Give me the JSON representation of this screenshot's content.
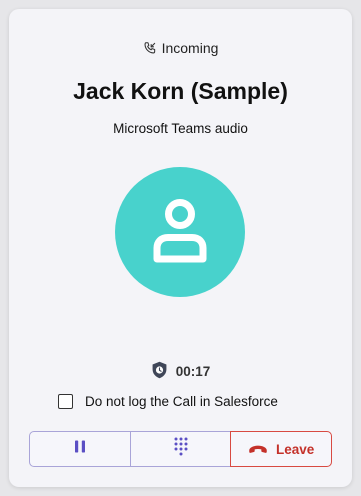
{
  "call": {
    "status_label": "Incoming",
    "caller_name": "Jack Korn (Sample)",
    "audio_label": "Microsoft Teams audio",
    "duration": "00:17"
  },
  "options": {
    "do_not_log_label": "Do not log the Call in Salesforce",
    "do_not_log_checked": false
  },
  "controls": {
    "leave_label": "Leave"
  },
  "colors": {
    "avatar_bg": "#48d2cc",
    "accent": "#5b4fc4",
    "leave": "#c4312a",
    "card_bg": "#f4f4f8"
  },
  "icons": {
    "status": "incoming-call-icon",
    "avatar": "person-icon",
    "timer": "shield-clock-icon",
    "hold": "pause-icon",
    "dialpad": "dialpad-icon",
    "leave": "hang-up-icon"
  }
}
